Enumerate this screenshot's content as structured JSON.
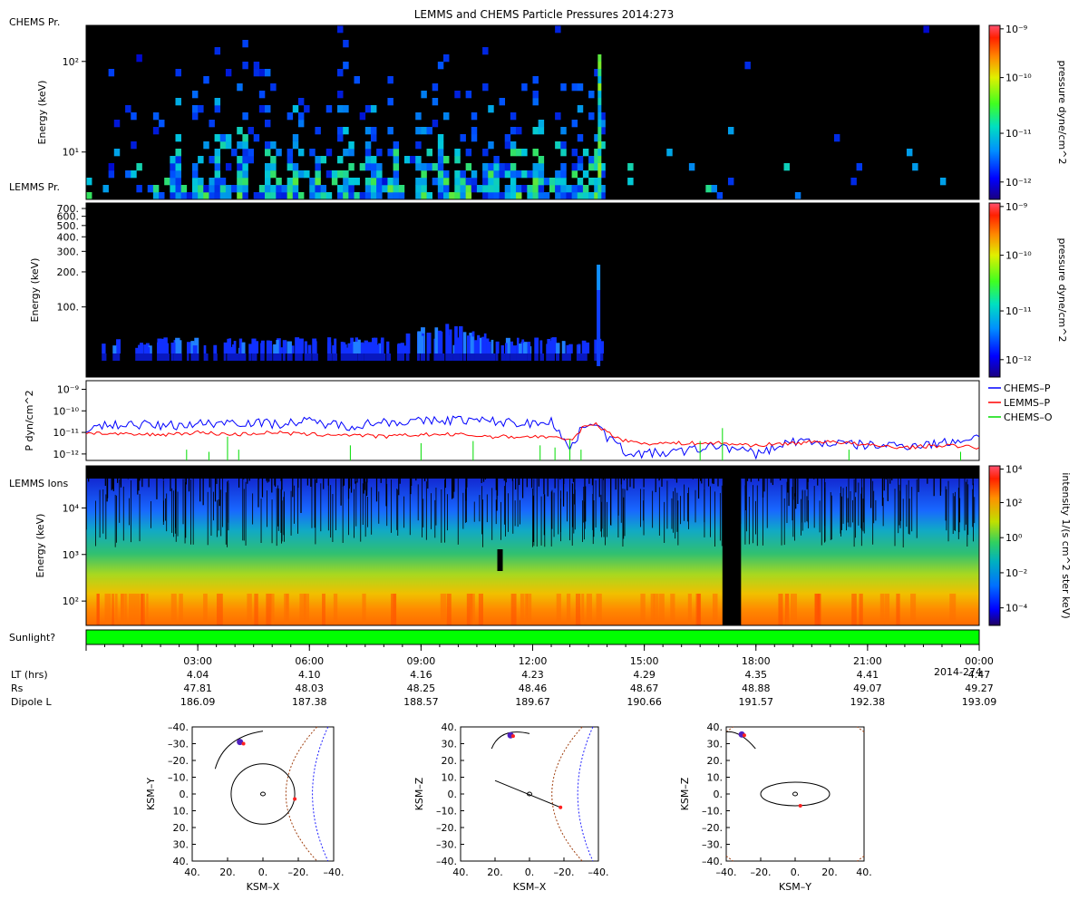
{
  "title": "LEMMS and CHEMS Particle Pressures  2014:273",
  "panels": {
    "chems": {
      "label": "CHEMS Pr.",
      "ylabel": "Energy (keV)",
      "yticks": [
        {
          "v": 100,
          "label": "10²"
        },
        {
          "v": 10,
          "label": "10¹"
        }
      ],
      "yscale": "log",
      "ylim": [
        3,
        250
      ],
      "colorbar": {
        "label": "pressure dyne/cm^2",
        "ticks": [
          "10⁻⁹",
          "10⁻¹⁰",
          "10⁻¹¹",
          "10⁻¹²"
        ]
      }
    },
    "lemms_pr": {
      "label": "LEMMS Pr.",
      "ylabel": "Energy (keV)",
      "yticks": [
        {
          "v": 700,
          "label": "700."
        },
        {
          "v": 600,
          "label": "600."
        },
        {
          "v": 500,
          "label": "500."
        },
        {
          "v": 400,
          "label": "400."
        },
        {
          "v": 300,
          "label": "300."
        },
        {
          "v": 200,
          "label": "200."
        },
        {
          "v": 100,
          "label": "100."
        }
      ],
      "yscale": "log",
      "ylim": [
        25,
        780
      ],
      "colorbar": {
        "label": "pressure dyne/cm^2",
        "ticks": [
          "10⁻⁹",
          "10⁻¹⁰",
          "10⁻¹¹",
          "10⁻¹²"
        ]
      }
    },
    "pressure": {
      "ylabel": "P dyn/cm^2",
      "yticks": [
        {
          "v": -9,
          "label": "10⁻⁹"
        },
        {
          "v": -10,
          "label": "10⁻¹⁰"
        },
        {
          "v": -11,
          "label": "10⁻¹¹"
        },
        {
          "v": -12,
          "label": "10⁻¹²"
        }
      ],
      "legend": [
        {
          "name": "CHEMS–P",
          "color": "#0000ff"
        },
        {
          "name": "LEMMS–P",
          "color": "#ff0000"
        },
        {
          "name": "CHEMS–O",
          "color": "#00dd00"
        }
      ]
    },
    "ions": {
      "label": "LEMMS Ions",
      "ylabel": "Energy (keV)",
      "yticks": [
        {
          "v": 10000,
          "label": "10⁴"
        },
        {
          "v": 1000,
          "label": "10³"
        },
        {
          "v": 100,
          "label": "10²"
        }
      ],
      "yscale": "log",
      "ylim": [
        30,
        80000
      ],
      "colorbar": {
        "label": "intensity 1/(s cm^2 ster keV)",
        "ticks": [
          "10⁴",
          "10²",
          "10⁰",
          "10⁻²",
          "10⁻⁴"
        ]
      }
    },
    "sunlight": {
      "label": "Sunlight?",
      "color": "#00ff00"
    }
  },
  "time_axis": {
    "ticks": [
      "03:00",
      "06:00",
      "09:00",
      "12:00",
      "15:00",
      "18:00",
      "21:00",
      "00:00"
    ],
    "end_date": "2014-274",
    "rows": [
      {
        "name": "LT (hrs)",
        "values": [
          "4.04",
          "4.10",
          "4.16",
          "4.23",
          "4.29",
          "4.35",
          "4.41",
          "4.47"
        ]
      },
      {
        "name": "Rs",
        "values": [
          "47.81",
          "48.03",
          "48.25",
          "48.46",
          "48.67",
          "48.88",
          "49.07",
          "49.27"
        ]
      },
      {
        "name": "Dipole L",
        "values": [
          "186.09",
          "187.38",
          "188.57",
          "189.67",
          "190.66",
          "191.57",
          "192.38",
          "193.09"
        ]
      }
    ]
  },
  "orbit_plots": [
    {
      "xlabel": "KSM–X",
      "ylabel": "KSM–Y",
      "xticks": [
        "40.",
        "20.",
        "0.",
        "–20.",
        "–40."
      ],
      "yticks": [
        "–40.",
        "–30.",
        "–20.",
        "–10.",
        "0.",
        "10.",
        "20.",
        "30.",
        "40."
      ]
    },
    {
      "xlabel": "KSM–X",
      "ylabel": "KSM–Z",
      "xticks": [
        "40.",
        "20.",
        "0.",
        "–20.",
        "–40."
      ],
      "yticks": [
        "40.",
        "30.",
        "20.",
        "10.",
        "0.",
        "–10.",
        "–20.",
        "–30.",
        "–40."
      ]
    },
    {
      "xlabel": "KSM–Y",
      "ylabel": "KSM–Z",
      "xticks": [
        "–40.",
        "–20.",
        "0.",
        "20.",
        "40."
      ],
      "yticks": [
        "40.",
        "30.",
        "20.",
        "10.",
        "0.",
        "–10.",
        "–20.",
        "–30.",
        "–40."
      ]
    }
  ],
  "chart_data": [
    {
      "type": "heatmap",
      "panel": "CHEMS Pr.",
      "x_range_hours": [
        0,
        24
      ],
      "ylim_kev": [
        3,
        250
      ],
      "yscale": "log",
      "colorscale": "pressure dyne/cm^2",
      "clim": [
        1e-12,
        1e-09
      ],
      "description": "sparse blue-green pixels below ~100 keV until ~13:50, almost empty after"
    },
    {
      "type": "heatmap",
      "panel": "LEMMS Pr.",
      "x_range_hours": [
        0,
        24
      ],
      "ylim_kev": [
        25,
        780
      ],
      "yscale": "log",
      "colorscale": "pressure dyne/cm^2",
      "clim": [
        1e-12,
        1e-09
      ],
      "description": "narrow band near ~40 keV in bursts until ~13:50, spike to ~250 keV at ~13:45"
    },
    {
      "type": "line",
      "panel": "P dyn/cm^2",
      "x_range_hours": [
        0,
        24
      ],
      "yscale": "log",
      "ylim_log10": [
        -12.3,
        -8.6
      ],
      "series": [
        {
          "name": "CHEMS–P",
          "x": [
            0,
            1,
            2,
            3,
            4,
            5,
            6,
            7,
            8,
            9,
            10,
            11,
            12,
            12.5,
            13,
            13.4,
            13.7,
            14,
            14.5,
            15,
            16,
            17,
            18,
            19,
            20,
            21,
            22,
            23,
            24
          ],
          "log10_y": [
            -10.8,
            -10.6,
            -10.7,
            -10.6,
            -10.5,
            -10.6,
            -10.5,
            -10.7,
            -10.5,
            -10.5,
            -10.4,
            -10.5,
            -10.6,
            -10.4,
            -11.8,
            -10.6,
            -10.5,
            -11.2,
            -11.9,
            -12.0,
            -11.9,
            -11.6,
            -12.0,
            -11.4,
            -11.5,
            -11.6,
            -11.6,
            -11.5,
            -11.2
          ]
        },
        {
          "name": "LEMMS–P",
          "x": [
            0,
            1,
            2,
            3,
            4,
            5,
            6,
            7,
            8,
            9,
            10,
            11,
            12,
            12.5,
            13,
            13.4,
            13.7,
            14,
            14.5,
            15,
            16,
            17,
            18,
            19,
            20,
            21,
            22,
            23,
            24
          ],
          "log10_y": [
            -11.0,
            -11.1,
            -11.1,
            -11.0,
            -11.1,
            -11.0,
            -11.1,
            -11.1,
            -11.2,
            -11.1,
            -11.1,
            -11.2,
            -11.2,
            -11.2,
            -11.4,
            -10.7,
            -10.6,
            -11.0,
            -11.4,
            -11.5,
            -11.5,
            -11.5,
            -11.6,
            -11.5,
            -11.4,
            -11.6,
            -11.7,
            -11.6,
            -11.7
          ]
        },
        {
          "name": "CHEMS–O",
          "x": [
            2.7,
            3.3,
            3.8,
            4.1,
            7.1,
            9.0,
            10.4,
            12.2,
            12.6,
            13.0,
            13.3,
            16.5,
            17.1,
            20.5,
            23.5
          ],
          "log10_y": [
            -11.8,
            -11.9,
            -11.2,
            -11.8,
            -11.6,
            -11.5,
            -11.4,
            -11.6,
            -11.7,
            -11.3,
            -11.8,
            -11.4,
            -10.8,
            -11.8,
            -11.9
          ]
        }
      ]
    },
    {
      "type": "heatmap",
      "panel": "LEMMS Ions",
      "x_range_hours": [
        0,
        24
      ],
      "ylim_kev": [
        30,
        80000
      ],
      "yscale": "log",
      "colorscale": "intensity 1/(s cm^2 ster keV)",
      "clim": [
        1e-05,
        10000.0
      ],
      "data_gap_hours": [
        17.1,
        17.6
      ],
      "description": "orange/red below ~80 keV grading to yellow/green, blue above ~3000 keV, spiky blue above 10^4"
    }
  ]
}
